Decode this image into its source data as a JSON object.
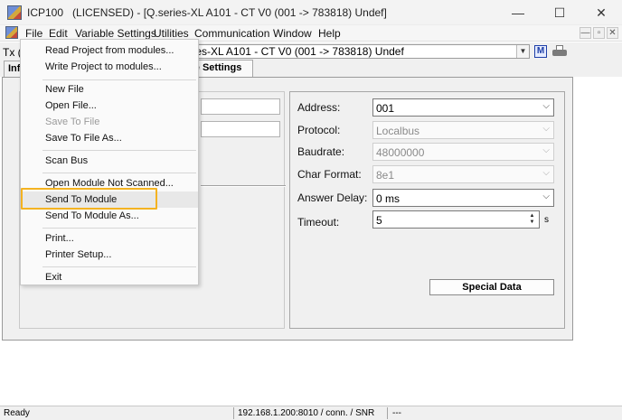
{
  "titlebar": {
    "title": "ICP100   (LICENSED) - [Q.series-XL A101 - CT V0 (001 -> 783818) Undef]",
    "min_glyph": "—",
    "max_glyph": "☐",
    "close_glyph": "✕"
  },
  "menubar": {
    "items": [
      "File",
      "Edit",
      "Variable Settings",
      "Utilities",
      "Communication",
      "Window",
      "Help"
    ],
    "mdi_buttons": [
      "—",
      "▫",
      "✕"
    ]
  },
  "toolbar": {
    "tx_label": "Tx (",
    "module_selector": "eries-XL A101 - CT V0 (001 -> 783818) Undef",
    "arrow": "▼",
    "m_icon_label": "M"
  },
  "tabs": [
    {
      "label": "Inf",
      "active": false
    },
    {
      "label": "ule Settings",
      "active": true
    }
  ],
  "file_menu": {
    "items": [
      {
        "label": "Read Project from modules...",
        "enabled": true
      },
      {
        "label": "Write Project to modules...",
        "enabled": true
      },
      {
        "label": "New File",
        "enabled": true
      },
      {
        "label": "Open File...",
        "enabled": true
      },
      {
        "label": "Save To File",
        "enabled": false
      },
      {
        "label": "Save To File As...",
        "enabled": true
      },
      {
        "label": "Scan Bus",
        "enabled": true
      },
      {
        "label": "Open Module Not Scanned...",
        "enabled": true
      },
      {
        "label": "Send To Module",
        "enabled": true,
        "highlighted": true
      },
      {
        "label": "Send To Module As...",
        "enabled": true
      },
      {
        "label": "Print...",
        "enabled": true
      },
      {
        "label": "Printer Setup...",
        "enabled": true
      },
      {
        "label": "Exit",
        "enabled": true
      }
    ],
    "highlight_color": "#f4b321"
  },
  "module_settings": {
    "address": {
      "label": "Address:",
      "value": "001",
      "enabled": true
    },
    "protocol": {
      "label": "Protocol:",
      "value": "Localbus",
      "enabled": false
    },
    "baudrate": {
      "label": "Baudrate:",
      "value": "48000000",
      "enabled": false
    },
    "char_format": {
      "label": "Char Format:",
      "value": "8e1",
      "enabled": false
    },
    "answer_delay": {
      "label": "Answer Delay:",
      "value": "0 ms",
      "enabled": true
    },
    "timeout": {
      "label": "Timeout:",
      "value": "5",
      "unit": "s",
      "enabled": true
    },
    "special_data_button": "Special Data",
    "combo_arrow": "⌵",
    "spin_up": "▲",
    "spin_down": "▼"
  },
  "statusbar": {
    "status": "Ready",
    "connection": "192.168.1.200:8010 / conn. / SNR",
    "extra": "---"
  }
}
